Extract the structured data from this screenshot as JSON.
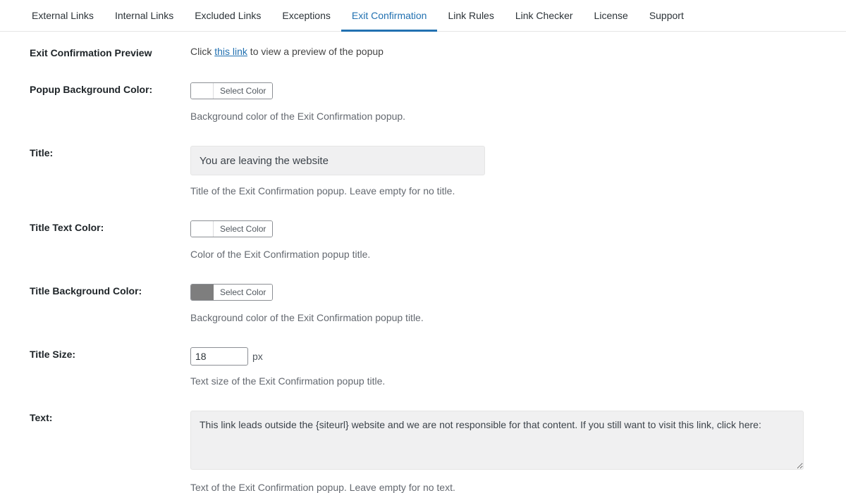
{
  "tabs": [
    {
      "label": "External Links",
      "active": false
    },
    {
      "label": "Internal Links",
      "active": false
    },
    {
      "label": "Excluded Links",
      "active": false
    },
    {
      "label": "Exceptions",
      "active": false
    },
    {
      "label": "Exit Confirmation",
      "active": true
    },
    {
      "label": "Link Rules",
      "active": false
    },
    {
      "label": "Link Checker",
      "active": false
    },
    {
      "label": "License",
      "active": false
    },
    {
      "label": "Support",
      "active": false
    }
  ],
  "labels": {
    "preview": "Exit Confirmation Preview",
    "bgcolor": "Popup Background Color:",
    "title": "Title:",
    "titlecolor": "Title Text Color:",
    "titlebgcolor": "Title Background Color:",
    "titlesize": "Title Size:",
    "text": "Text:"
  },
  "preview": {
    "before": "Click ",
    "link": "this link",
    "after": " to view a preview of the popup"
  },
  "selectColor": "Select Color",
  "swatches": {
    "popup_bg": "#ffffff",
    "title_text": "#ffffff",
    "title_bg": "#7e7e7e"
  },
  "desc": {
    "bgcolor": "Background color of the Exit Confirmation popup.",
    "title": "Title of the Exit Confirmation popup. Leave empty for no title.",
    "titlecolor": "Color of the Exit Confirmation popup title.",
    "titlebgcolor": "Background color of the Exit Confirmation popup title.",
    "titlesize": "Text size of the Exit Confirmation popup title.",
    "text": "Text of the Exit Confirmation popup. Leave empty for no text."
  },
  "values": {
    "title": "You are leaving the website",
    "titlesize": "18",
    "text": "This link leads outside the {siteurl} website and we are not responsible for that content. If you still want to visit this link, click here:"
  },
  "unit_px": "px"
}
